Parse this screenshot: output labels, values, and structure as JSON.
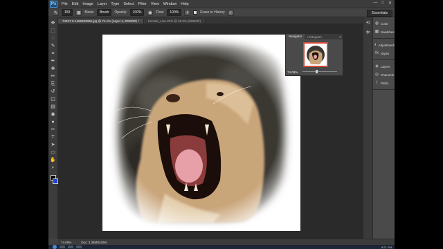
{
  "app": {
    "logo": "Ps",
    "menu": [
      "File",
      "Edit",
      "Image",
      "Layer",
      "Type",
      "Select",
      "Filter",
      "View",
      "Window",
      "Help"
    ],
    "window_controls": [
      "—",
      "□",
      "✕"
    ]
  },
  "options": {
    "brush_size": "150",
    "mode_label": "Mode:",
    "mode_value": "Brush",
    "opacity_label": "Opacity:",
    "opacity_value": "100%",
    "flow_label": "Flow:",
    "flow_value": "100%",
    "erase_history_label": "Erase to History",
    "workspace": "Essentials"
  },
  "tabs": [
    {
      "label": "74627-0-1459332036.jpg @ 74.1% (Layer 1, RGB/8#) *",
      "active": true
    },
    {
      "label": "Female_Lion.JPG @ 33.3% (RGB/8#)",
      "active": false
    }
  ],
  "tools": [
    "move-icon",
    "marquee-icon",
    "lasso-icon",
    "quick-select-icon",
    "crop-icon",
    "eyedropper-icon",
    "healing-icon",
    "brush-icon",
    "clone-stamp-icon",
    "history-brush-icon",
    "eraser-icon",
    "gradient-icon",
    "blur-icon",
    "dodge-icon",
    "pen-icon",
    "type-icon",
    "path-select-icon",
    "shape-icon",
    "hand-icon",
    "zoom-icon"
  ],
  "tool_glyphs": [
    "✥",
    "⬚",
    "◌",
    "✎",
    "⌗",
    "✒",
    "✚",
    "✏",
    "⎘",
    "↺",
    "◫",
    "▤",
    "◉",
    "●",
    "✑",
    "T",
    "➤",
    "▭",
    "✋",
    "⌕"
  ],
  "navigator": {
    "tabs": [
      "Navigator",
      "Histogram"
    ],
    "zoom": "74.08%"
  },
  "panels": [
    {
      "group": [
        {
          "icon": "color-icon",
          "label": "Color",
          "glyph": "◍"
        },
        {
          "icon": "swatches-icon",
          "label": "Swatches",
          "glyph": "▦"
        }
      ]
    },
    {
      "group": [
        {
          "icon": "adjustments-icon",
          "label": "Adjustments",
          "glyph": "◐"
        },
        {
          "icon": "styles-icon",
          "label": "Styles",
          "glyph": "fx"
        }
      ]
    },
    {
      "group": [
        {
          "icon": "layers-icon",
          "label": "Layers",
          "glyph": "◈"
        },
        {
          "icon": "channels-icon",
          "label": "Channels",
          "glyph": "◎"
        },
        {
          "icon": "paths-icon",
          "label": "Paths",
          "glyph": "⌇"
        }
      ]
    }
  ],
  "status": {
    "zoom": "74.08%",
    "doc_size": "Doc: 3.38M/5.60M"
  },
  "taskbar": {
    "clock": "8:21 PM"
  }
}
